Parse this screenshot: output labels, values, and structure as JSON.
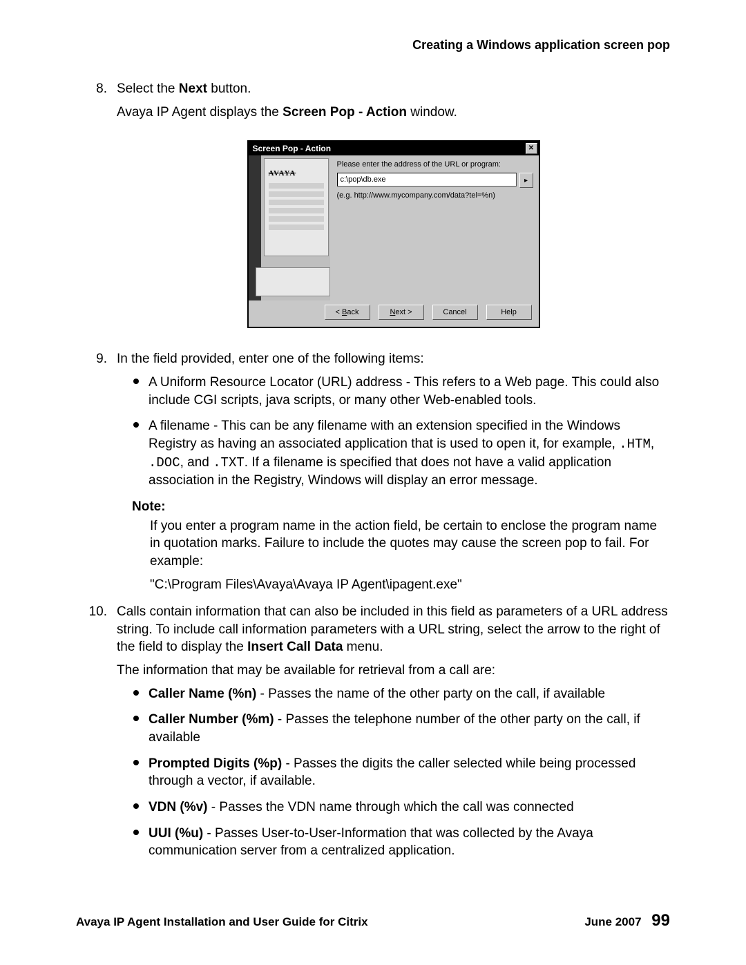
{
  "header_title": "Creating a Windows application screen pop",
  "step8": {
    "num": "8.",
    "line1_a": "Select the ",
    "line1_bold": "Next",
    "line1_b": " button.",
    "line2_a": "Avaya IP Agent displays the ",
    "line2_bold": "Screen Pop - Action",
    "line2_b": " window."
  },
  "dialog": {
    "title": "Screen Pop - Action",
    "close_glyph": "✕",
    "brand": "AVAYA",
    "prompt": "Please enter the address of the URL or program:",
    "input_value": "c:\\pop\\db.exe",
    "example": "(e.g. http://www.mycompany.com/data?tel=%n)",
    "arrow_glyph": "▸",
    "buttons": {
      "back_pre": "< ",
      "back_ul": "B",
      "back_post": "ack",
      "next_ul": "N",
      "next_post": "ext >",
      "cancel": "Cancel",
      "help": "Help"
    }
  },
  "step9": {
    "num": "9.",
    "intro": "In the field provided, enter one of the following items:",
    "b1": "A Uniform Resource Locator (URL) address - This refers to a Web page. This could also include CGI scripts, java scripts, or many other Web-enabled tools.",
    "b2_a": "A filename - This can be any filename with an extension specified in the Windows Registry as having an associated application that is used to open it, for example, ",
    "b2_m1": ".HTM",
    "b2_b": ", ",
    "b2_m2": ".DOC",
    "b2_c": ", and ",
    "b2_m3": ".TXT",
    "b2_d": ". If a filename is specified that does not have a valid application association in the Registry, Windows will display an error message.",
    "note_label": "Note:",
    "note_p1": "If you enter a program name in the action field, be certain to enclose the program name in quotation marks. Failure to include the quotes may cause the screen pop to fail. For example:",
    "note_p2": "\"C:\\Program Files\\Avaya\\Avaya IP Agent\\ipagent.exe\""
  },
  "step10": {
    "num": "10.",
    "p1_a": "Calls contain information that can also be included in this field as parameters of a URL address string. To include call information parameters with a URL string, select the arrow to the right of the field to display the ",
    "p1_bold": "Insert Call Data",
    "p1_b": " menu.",
    "p2": "The information that may be available for retrieval from a call are:",
    "items": {
      "i1_b": "Caller Name (%n)",
      "i1_t": " - Passes the name of the other party on the call, if available",
      "i2_b": "Caller Number (%m)",
      "i2_t": " - Passes the telephone number of the other party on the call, if available",
      "i3_b": "Prompted Digits (%p)",
      "i3_t": " - Passes the digits the caller selected while being processed through a vector, if available.",
      "i4_b": "VDN (%v)",
      "i4_t": " - Passes the VDN name through which the call was connected",
      "i5_b": "UUI (%u)",
      "i5_t": " - Passes User-to-User-Information that was collected by the Avaya communication server from a centralized application."
    }
  },
  "footer": {
    "left": "Avaya IP Agent Installation and User Guide for Citrix",
    "date": "June 2007",
    "page": "99"
  }
}
